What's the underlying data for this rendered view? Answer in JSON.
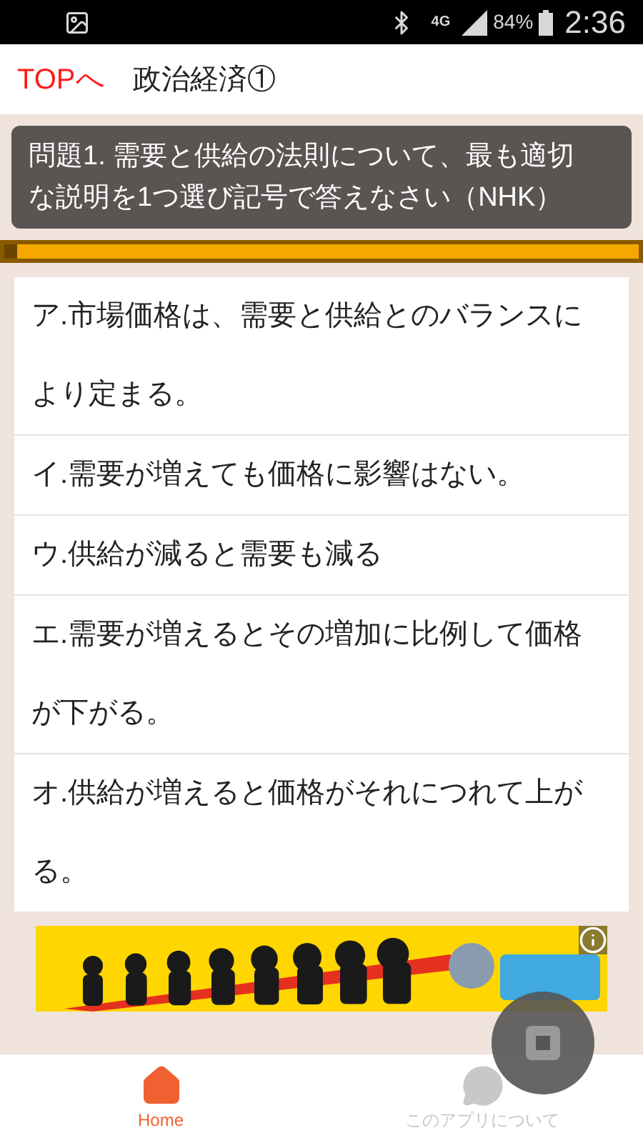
{
  "status_bar": {
    "network": "4G",
    "battery": "84%",
    "time": "2:36"
  },
  "header": {
    "back_link": "TOPへ",
    "title": "政治経済①"
  },
  "question": "問題1. 需要と供給の法則について、最も適切な説明を1つ選び記号で答えなさい（NHK）",
  "progress": {
    "level": 0.02
  },
  "choices": [
    "ア.市場価格は、需要と供給とのバランスにより定まる。",
    "イ.需要が増えても価格に影響はない。",
    "ウ.供給が減ると需要も減る",
    "エ.需要が増えるとその増加に比例して価格が下がる。",
    "オ.供給が増えると価格がそれにつれて上がる。"
  ],
  "bottom_nav": [
    {
      "label": "Home",
      "kind": "home",
      "selected": true
    },
    {
      "label": "このアプリについて",
      "kind": "about",
      "selected": false
    }
  ]
}
